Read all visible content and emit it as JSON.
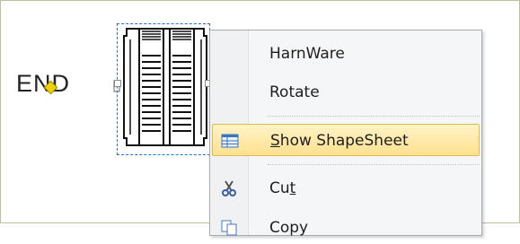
{
  "canvas": {
    "shape_label": "END"
  },
  "context_menu": {
    "items": [
      {
        "label": "HarnWare",
        "icon": ""
      },
      {
        "label": "Rotate",
        "icon": ""
      },
      {
        "label_pre": "",
        "label_ul": "S",
        "label_post": "how ShapeSheet",
        "icon": "shapesheet-icon",
        "highlighted": true
      },
      {
        "label_pre": "Cu",
        "label_ul": "t",
        "label_post": "",
        "icon": "scissors-icon"
      },
      {
        "label": "Copy",
        "icon": "copy-icon"
      }
    ]
  },
  "colors": {
    "highlight": "#ffe18f",
    "selection": "#2a6edc",
    "connector": "#f0d200"
  }
}
